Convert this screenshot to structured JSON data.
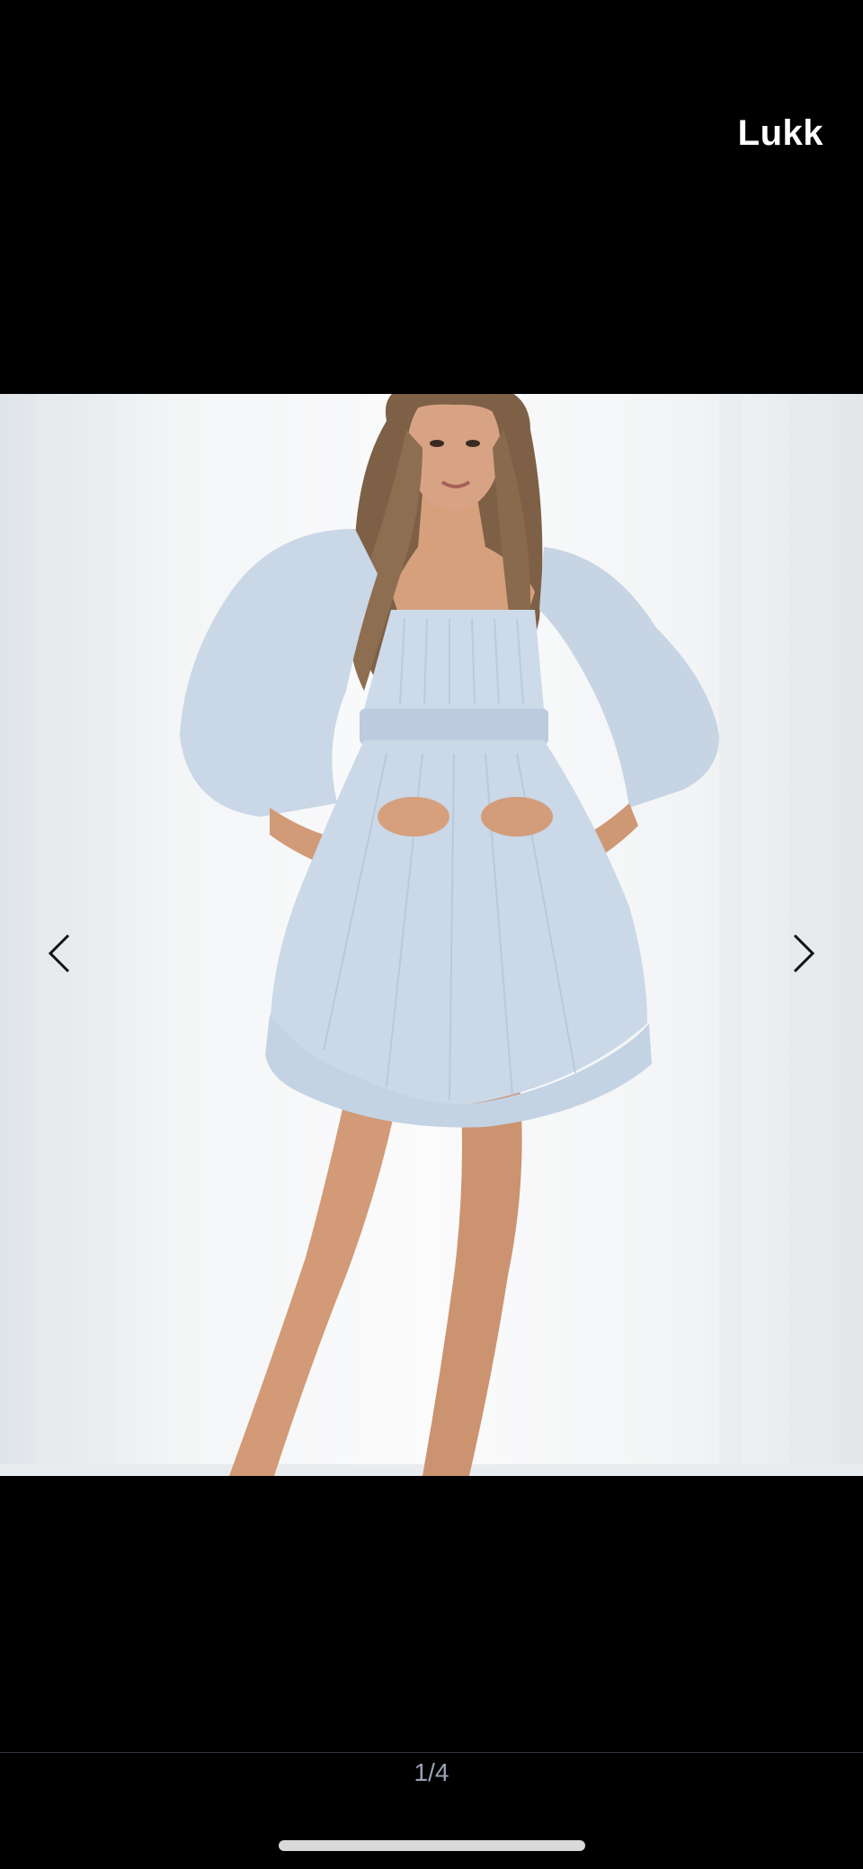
{
  "viewer": {
    "close_label": "Lukk",
    "page_indicator": "1/4",
    "current_page": 1,
    "total_pages": 4
  },
  "image": {
    "description_name": "product-photo",
    "dress_color": "#cfdcea",
    "skin_color": "#d49b78",
    "hair_color": "#8a6a4c"
  },
  "icons": {
    "prev": "chevron-left-icon",
    "next": "chevron-right-icon"
  }
}
